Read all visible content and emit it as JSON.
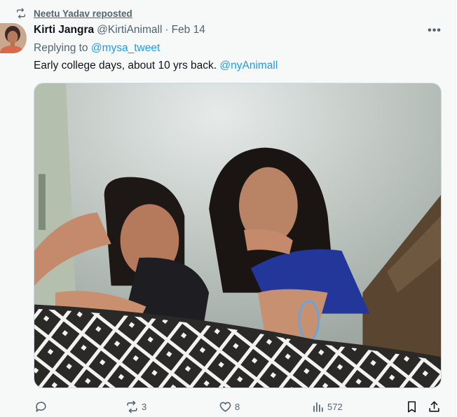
{
  "repost": {
    "label": "Neetu Yadav reposted"
  },
  "tweet": {
    "author_name": "Kirti Jangra",
    "author_handle": "@KirtiAnimall",
    "separator": "·",
    "date": "Feb 14",
    "replying_prefix": "Replying to ",
    "replying_to": "@mysa_tweet",
    "text": "Early college days, about 10 yrs back. ",
    "text_mention": "@nyAnimall",
    "more_label": "•••"
  },
  "actions": {
    "reply_count": "",
    "repost_count": "3",
    "like_count": "8",
    "views_count": "572"
  },
  "icons": {
    "repost": "repost-icon",
    "reply": "reply-icon",
    "like": "heart-icon",
    "views": "views-icon",
    "bookmark": "bookmark-icon",
    "share": "share-icon",
    "more": "more-icon"
  },
  "colors": {
    "link": "#1d9bf0",
    "secondary": "#536471",
    "primary": "#0f1419",
    "background": "#f7f9f9"
  }
}
